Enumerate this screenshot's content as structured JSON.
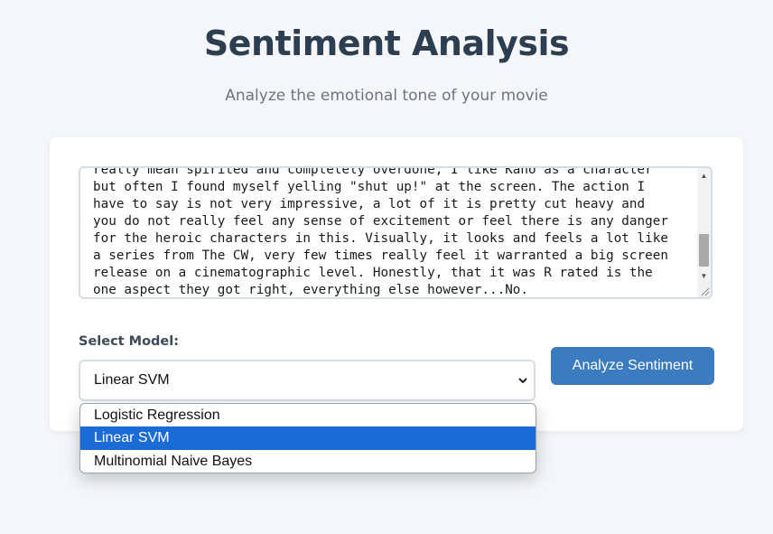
{
  "header": {
    "title": "Sentiment Analysis",
    "subtitle": "Analyze the emotional tone of your movie"
  },
  "review": {
    "lines": [
      "really mean spirited and completely overdone, I like Kano as a character",
      "but often I found myself yelling \"shut up!\" at the screen. The action I",
      "have to say is not very impressive, a lot of it is pretty cut heavy and",
      "you do not really feel any sense of excitement or feel there is any danger",
      "for the heroic characters in this. Visually, it looks and feels a lot like",
      "a series from The CW, very few times really feel it warranted a big screen",
      "release on a cinematographic level. Honestly, that it was R rated is the",
      "one aspect they got right, everything else however...No."
    ]
  },
  "model_select": {
    "label": "Select Model:",
    "selected": "Linear SVM",
    "options": [
      "Logistic Regression",
      "Linear SVM",
      "Multinomial Naive Bayes"
    ],
    "highlighted_index": 1
  },
  "actions": {
    "analyze_label": "Analyze Sentiment"
  },
  "colors": {
    "title": "#2c3e50",
    "button": "#3b7bc0",
    "highlight": "#1b6bd6"
  },
  "icons": {
    "select_chevron": "chevron-down-icon",
    "scroll_up": "scroll-up-arrow-icon",
    "scroll_down": "scroll-down-arrow-icon",
    "resize": "resize-handle-icon"
  }
}
